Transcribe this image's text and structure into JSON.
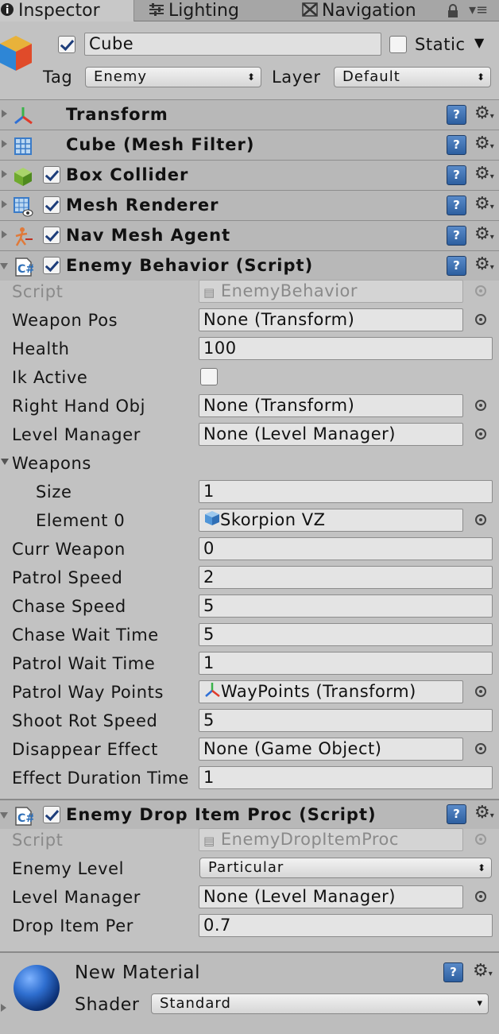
{
  "tabs": {
    "inspector": "Inspector",
    "lighting": "Lighting",
    "navigation": "Navigation"
  },
  "object": {
    "name": "Cube",
    "static_label": "Static",
    "tag_label": "Tag",
    "tag_value": "Enemy",
    "layer_label": "Layer",
    "layer_value": "Default",
    "active": true,
    "static": false
  },
  "components": [
    {
      "title": "Transform",
      "icon": "transform-icon"
    },
    {
      "title": "Cube (Mesh Filter)",
      "icon": "mesh-filter-icon"
    },
    {
      "title": "Box Collider",
      "icon": "box-collider-icon"
    },
    {
      "title": "Mesh Renderer",
      "icon": "mesh-renderer-icon"
    },
    {
      "title": "Nav Mesh Agent",
      "icon": "nav-mesh-agent-icon"
    },
    {
      "title": "Enemy Behavior (Script)",
      "icon": "script-icon"
    },
    {
      "title": "Enemy Drop Item Proc (Script)",
      "icon": "script-icon"
    }
  ],
  "enemy_behavior": {
    "script_label": "Script",
    "script_value": "EnemyBehavior",
    "weapon_pos_label": "Weapon Pos",
    "weapon_pos_value": "None (Transform)",
    "health_label": "Health",
    "health_value": "100",
    "ik_active_label": "Ik Active",
    "right_hand_label": "Right Hand Obj",
    "right_hand_value": "None (Transform)",
    "level_manager_label": "Level Manager",
    "level_manager_value": "None (Level Manager)",
    "weapons_label": "Weapons",
    "size_label": "Size",
    "size_value": "1",
    "element0_label": "Element 0",
    "element0_value": "Skorpion VZ",
    "curr_weapon_label": "Curr Weapon",
    "curr_weapon_value": "0",
    "patrol_speed_label": "Patrol Speed",
    "patrol_speed_value": "2",
    "chase_speed_label": "Chase Speed",
    "chase_speed_value": "5",
    "chase_wait_label": "Chase Wait Time",
    "chase_wait_value": "5",
    "patrol_wait_label": "Patrol Wait Time",
    "patrol_wait_value": "1",
    "patrol_way_label": "Patrol Way Points",
    "patrol_way_value": "WayPoints (Transform)",
    "shoot_rot_label": "Shoot Rot Speed",
    "shoot_rot_value": "5",
    "disappear_label": "Disappear Effect",
    "disappear_value": "None (Game Object)",
    "effect_dur_label": "Effect Duration Time",
    "effect_dur_value": "1"
  },
  "enemy_drop": {
    "script_label": "Script",
    "script_value": "EnemyDropItemProc",
    "enemy_level_label": "Enemy Level",
    "enemy_level_value": "Particular",
    "level_manager_label": "Level Manager",
    "level_manager_value": "None (Level Manager)",
    "drop_item_label": "Drop Item Per",
    "drop_item_value": "0.7"
  },
  "material": {
    "name": "New Material",
    "shader_label": "Shader",
    "shader_value": "Standard"
  },
  "colors": {
    "panel": "#c2c2c2",
    "header": "#b8b8b8",
    "accent": "#2d5fa0"
  }
}
